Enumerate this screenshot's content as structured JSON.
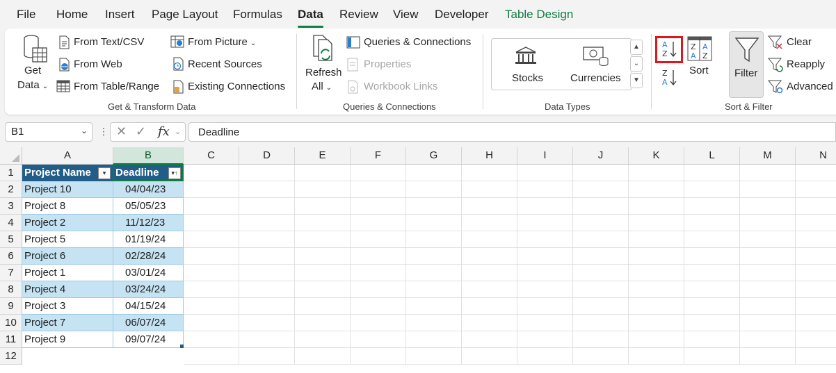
{
  "menu": {
    "tabs": [
      {
        "label": "File"
      },
      {
        "label": "Home"
      },
      {
        "label": "Insert"
      },
      {
        "label": "Page Layout"
      },
      {
        "label": "Formulas"
      },
      {
        "label": "Data",
        "active": true
      },
      {
        "label": "Review"
      },
      {
        "label": "View"
      },
      {
        "label": "Developer"
      },
      {
        "label": "Table Design",
        "contextual": true
      }
    ]
  },
  "ribbon": {
    "get_transform": {
      "get_data_1": "Get",
      "get_data_2": "Data",
      "from_text_csv": "From Text/CSV",
      "from_web": "From Web",
      "from_table_range": "From Table/Range",
      "from_picture": "From Picture",
      "recent_sources": "Recent Sources",
      "existing_connections": "Existing Connections",
      "group_label": "Get & Transform Data"
    },
    "queries": {
      "refresh_1": "Refresh",
      "refresh_2": "All",
      "queries_connections": "Queries & Connections",
      "properties": "Properties",
      "workbook_links": "Workbook Links",
      "group_label": "Queries & Connections"
    },
    "data_types": {
      "stocks": "Stocks",
      "currencies": "Currencies",
      "group_label": "Data Types"
    },
    "sort_filter": {
      "sort": "Sort",
      "filter": "Filter",
      "clear": "Clear",
      "reapply": "Reapply",
      "advanced": "Advanced",
      "group_label": "Sort & Filter"
    }
  },
  "formula_bar": {
    "name_box": "B1",
    "fx": "fx",
    "formula": "Deadline"
  },
  "grid": {
    "columns": [
      "A",
      "B",
      "C",
      "D",
      "E",
      "F",
      "G",
      "H",
      "I",
      "J",
      "K",
      "L",
      "M",
      "N"
    ],
    "row_numbers": [
      "1",
      "2",
      "3",
      "4",
      "5",
      "6",
      "7",
      "8",
      "9",
      "10",
      "11",
      "12"
    ],
    "table": {
      "headers": [
        "Project Name",
        "Deadline"
      ],
      "rows": [
        [
          "Project 10",
          "04/04/23"
        ],
        [
          "Project 8",
          "05/05/23"
        ],
        [
          "Project 2",
          "11/12/23"
        ],
        [
          "Project 5",
          "01/19/24"
        ],
        [
          "Project 6",
          "02/28/24"
        ],
        [
          "Project 1",
          "03/01/24"
        ],
        [
          "Project 4",
          "03/24/24"
        ],
        [
          "Project 3",
          "04/15/24"
        ],
        [
          "Project 7",
          "06/07/24"
        ],
        [
          "Project 9",
          "09/07/24"
        ]
      ]
    }
  },
  "colors": {
    "accent": "#107c41",
    "table_header": "#215d88",
    "table_band": "#c5e3f3",
    "highlight": "#e0161b"
  },
  "icons": [
    "get-data-icon",
    "text-csv-icon",
    "web-icon",
    "table-range-icon",
    "picture-icon",
    "recent-sources-icon",
    "existing-connections-icon",
    "refresh-icon",
    "queries-icon",
    "properties-icon",
    "workbook-links-icon",
    "stocks-icon",
    "currencies-icon",
    "sort-ascending-icon",
    "sort-descending-icon",
    "sort-icon",
    "filter-icon",
    "clear-filter-icon",
    "reapply-icon",
    "advanced-filter-icon"
  ]
}
